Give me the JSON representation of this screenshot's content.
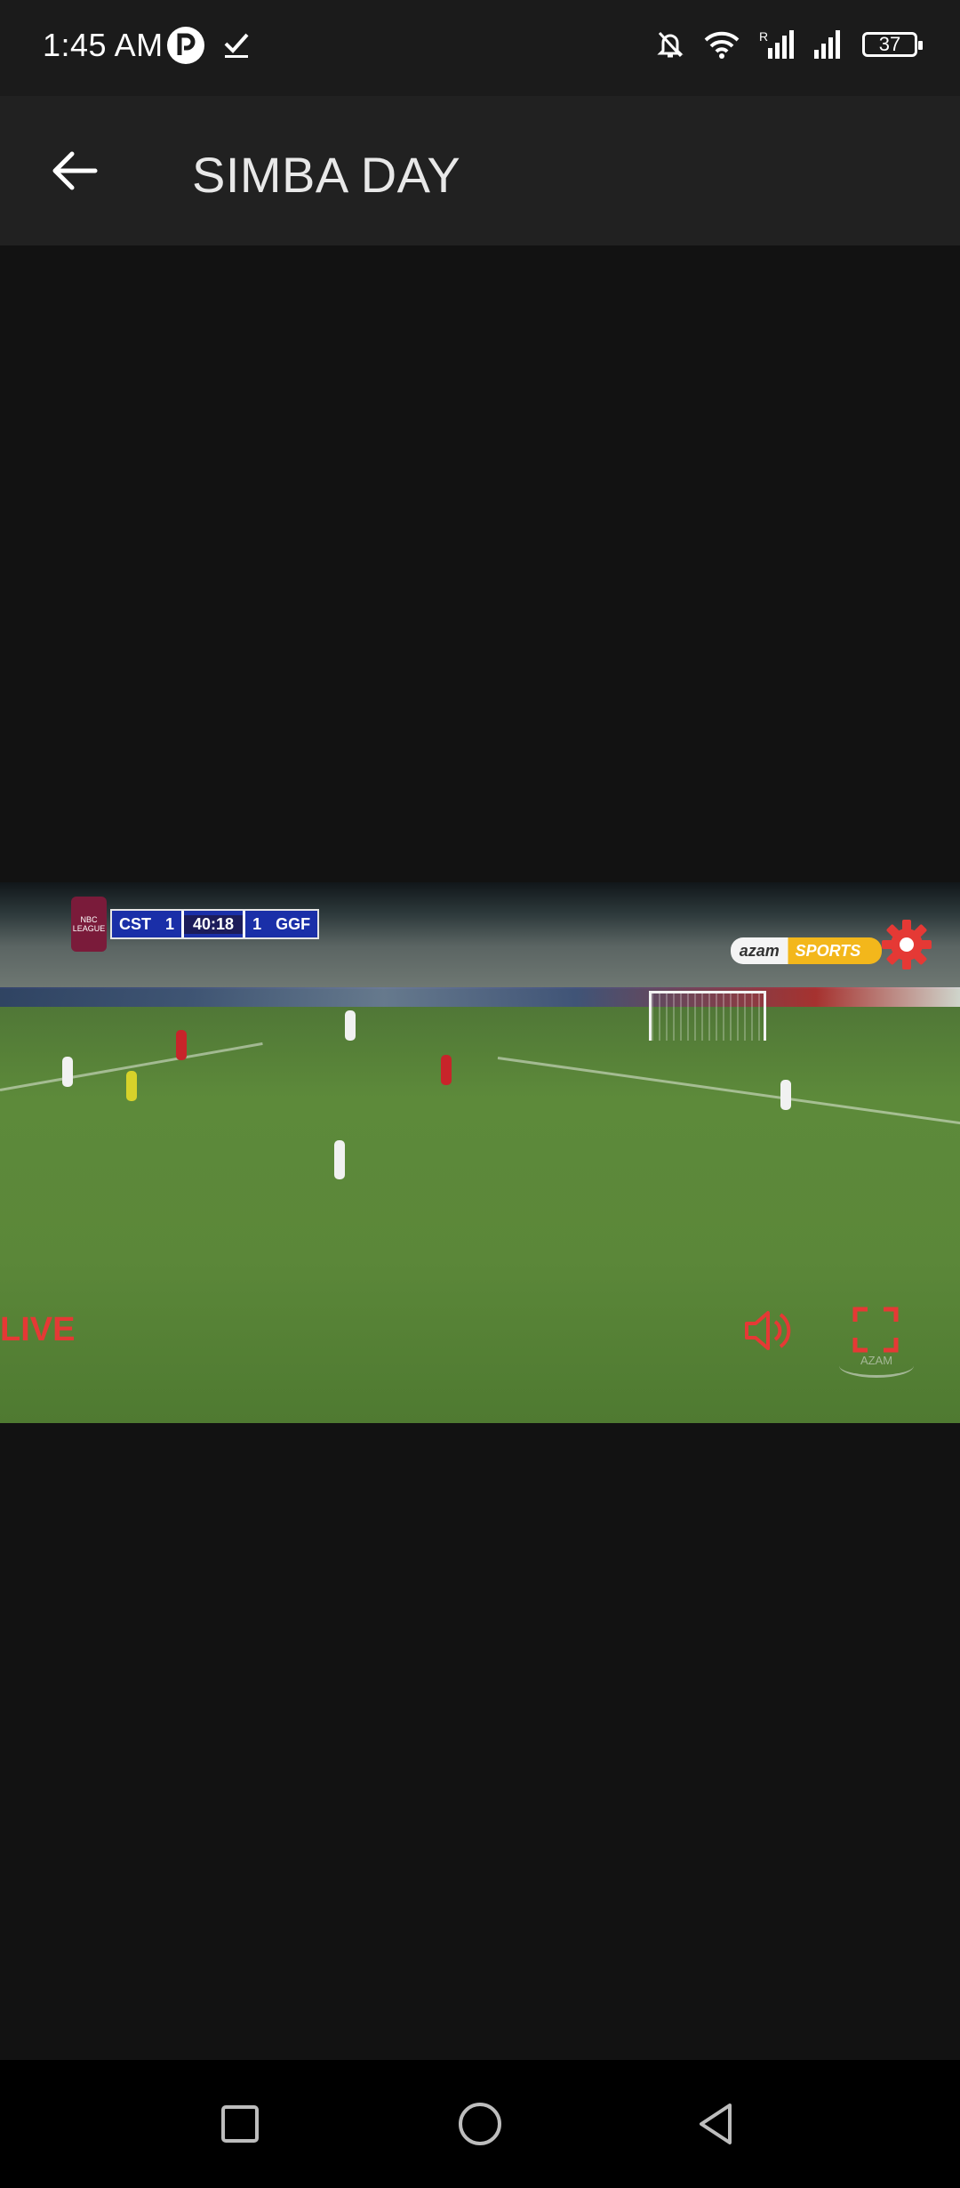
{
  "status_bar": {
    "time": "1:45 AM",
    "battery": "37",
    "icons": [
      "app-notification-icon",
      "check-icon",
      "mute-notifications-icon",
      "wifi-icon",
      "signal-r-icon",
      "signal-icon",
      "battery-icon"
    ]
  },
  "app_bar": {
    "title": "SIMBA DAY",
    "back_icon": "arrow-left-icon"
  },
  "player": {
    "scoreboard": {
      "league_logo_text": "NBC LEAGUE",
      "home_team": "CST",
      "home_score": "1",
      "clock": "40:18",
      "away_score": "1",
      "away_team": "GGF"
    },
    "broadcaster": {
      "part1": "azam",
      "part2": "SPORTS"
    },
    "watermark": "AZAM",
    "live_label": "LIVE",
    "controls": [
      "settings-icon",
      "volume-icon",
      "fullscreen-icon"
    ],
    "accent_color": "#e53935"
  },
  "nav_bar": {
    "buttons": [
      "recent-apps-icon",
      "home-icon",
      "back-triangle-icon"
    ]
  }
}
